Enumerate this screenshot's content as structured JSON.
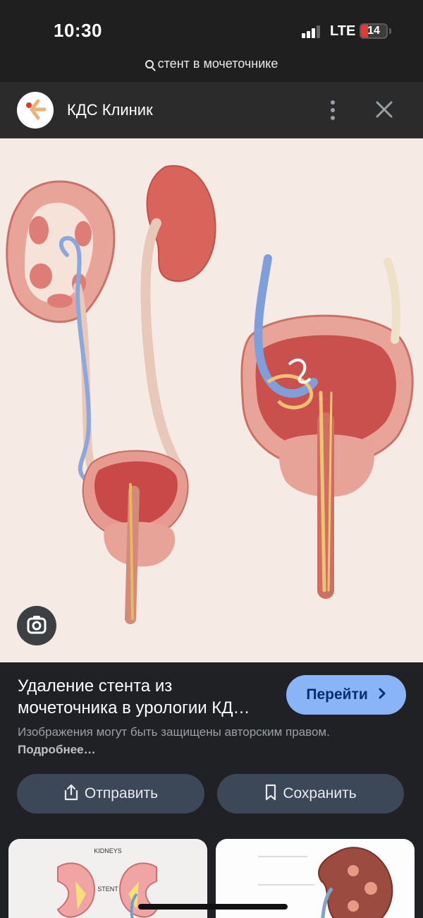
{
  "status_bar": {
    "time": "10:30",
    "network": "LTE",
    "battery": "14"
  },
  "url_bar": {
    "query": "стент в мочеточнике"
  },
  "header": {
    "site_name": "КДС Клиник"
  },
  "result": {
    "title": "Удаление стента из мочеточника в урологии КД…",
    "visit_label": "Перейти",
    "copyright_text": "Изображения могут быть защищены авторским правом.",
    "more_link": "Подробнее…"
  },
  "actions": {
    "share_label": "Отправить",
    "save_label": "Сохранить"
  },
  "thumbnails": {
    "first": {
      "kidneys_label": "KIDNEYS",
      "stent_label": "STENT"
    }
  },
  "colors": {
    "accent": "#8ab4f8",
    "background": "#202124",
    "pill": "#3c4858"
  },
  "icons": [
    "search-icon",
    "more-vert-icon",
    "close-icon",
    "lens-icon",
    "share-icon",
    "bookmark-icon",
    "chevron-right-icon"
  ]
}
